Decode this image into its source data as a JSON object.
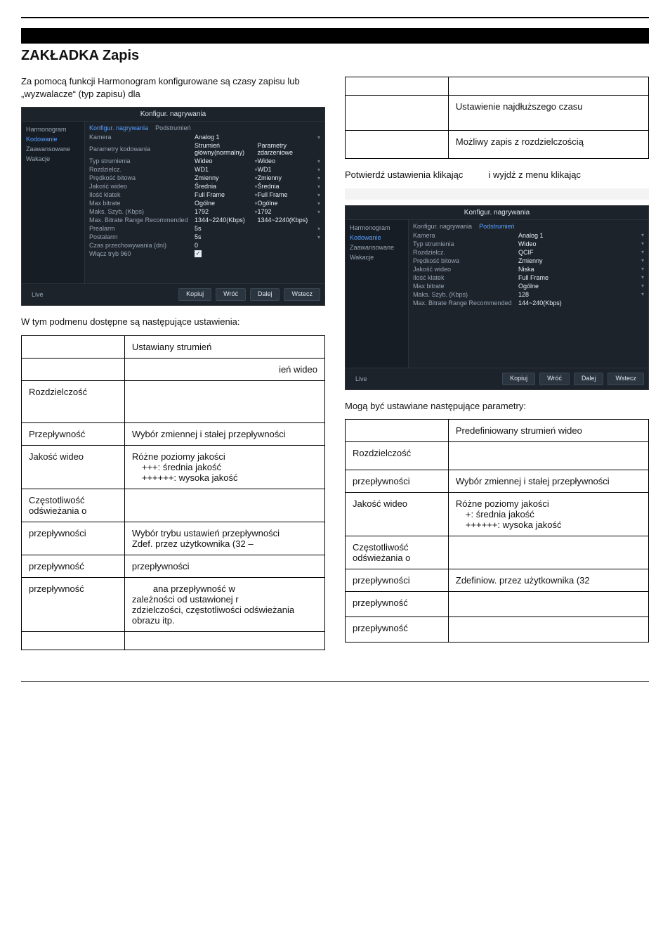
{
  "header": {
    "tab_title": "ZAKŁADKA Zapis"
  },
  "left": {
    "intro": "Za pomocą funkcji Harmonogram konfigurowane są czasy zapisu lub „wyzwalacze“ (typ zapisu) dla",
    "shot": {
      "title": "Konfigur. nagrywania",
      "side": {
        "harmonogram": "Harmonogram",
        "kodowanie": "Kodowanie",
        "zaawansowane": "Zaawansowane",
        "wakacje": "Wakacje"
      },
      "tabs": {
        "a": "Konfigur. nagrywania",
        "b": "Podstrumień"
      },
      "rows": {
        "kamera": {
          "lab": "Kamera",
          "val": "Analog 1"
        },
        "param_kod": {
          "lab": "Parametry kodowania",
          "val": "Strumień główny(normalny)",
          "val2": "Parametry zdarzeniowe"
        },
        "typ_str": {
          "lab": "Typ strumienia",
          "val": "Wideo",
          "val2": "Wideo"
        },
        "rozdz": {
          "lab": "Rozdzielcz.",
          "val": "WD1",
          "val2": "WD1"
        },
        "predk": {
          "lab": "Prędkość bitowa",
          "val": "Zmienny",
          "val2": "Zmienny"
        },
        "jakosc": {
          "lab": "Jakość wideo",
          "val": "Średnia",
          "val2": "Średnia"
        },
        "ilosc": {
          "lab": "Ilość klatek",
          "val": "Full Frame",
          "val2": "Full Frame"
        },
        "max_bit": {
          "lab": "Max bitrate",
          "val": "Ogólne",
          "val2": "Ogólne"
        },
        "maks_szyb": {
          "lab": "Maks. Szyb. (Kbps)",
          "val": "1792",
          "val2": "1792"
        },
        "range": {
          "lab": "Max. Bitrate Range Recommended",
          "val": "1344~2240(Kbps)",
          "val2": "1344~2240(Kbps)"
        },
        "prealarm": {
          "lab": "Prealarm",
          "val": "5s"
        },
        "postalarm": {
          "lab": "Postalarm",
          "val": "5s"
        },
        "czas": {
          "lab": "Czas przechowywania (dni)",
          "val": "0"
        },
        "wlacz": {
          "lab": "Włącz tryb 960"
        }
      },
      "buttons": {
        "live": "Live",
        "kopiuj": "Kopiuj",
        "wroc": "Wróć",
        "dalej": "Dalej",
        "wstecz": "Wstecz"
      }
    },
    "subhead": "W tym podmenu dostępne są następujące ustawienia:",
    "table": {
      "r1v": "Ustawiany strumień",
      "r2v": "ień wideo",
      "r3k": "Rozdzielczość",
      "r4k": "Przepływność",
      "r4v": "Wybór zmiennej i stałej przepływności",
      "r5k": "Jakość wideo",
      "r5v1": "Różne poziomy jakości",
      "r5v2": "+++: średnia jakość",
      "r5v3": "++++++: wysoka jakość",
      "r6k": "Częstotliwość odświeżania o",
      "r7k": "przepływności",
      "r7v1": "Wybór trybu ustawień przepływności",
      "r7v2": "Zdef. przez użytkownika (32 –",
      "r8k": "przepływność",
      "r8v": "przepływności",
      "r9k": "przepływność",
      "r9v1": "ana przepływność w",
      "r9v2": "zależności od ustawionej r",
      "r9v3": "zdzielczości, częstotliwości odświeżania obrazu itp."
    }
  },
  "right": {
    "top_table": {
      "r1": "Ustawienie najdłuższego czasu",
      "r2": "Możliwy zapis z rozdzielczością"
    },
    "confirm_line_a": "Potwierdź ustawienia klikając",
    "confirm_line_b": "i wyjdź z menu klikając",
    "shot": {
      "title": "Konfigur. nagrywania",
      "side": {
        "harmonogram": "Harmonogram",
        "kodowanie": "Kodowanie",
        "zaawansowane": "Zaawansowane",
        "wakacje": "Wakacje"
      },
      "tabs": {
        "a": "Konfigur. nagrywania",
        "b": "Podstrumień"
      },
      "rows": {
        "kamera": {
          "lab": "Kamera",
          "val": "Analog 1"
        },
        "typ_str": {
          "lab": "Typ strumienia",
          "val": "Wideo"
        },
        "rozdz": {
          "lab": "Rozdzielcz.",
          "val": "QCIF"
        },
        "predk": {
          "lab": "Prędkość bitowa",
          "val": "Zmienny"
        },
        "jakosc": {
          "lab": "Jakość wideo",
          "val": "Niska"
        },
        "ilosc": {
          "lab": "Ilość klatek",
          "val": "Full Frame"
        },
        "max_bit": {
          "lab": "Max bitrate",
          "val": "Ogólne"
        },
        "maks_szyb": {
          "lab": "Maks. Szyb. (Kbps)",
          "val": "128"
        },
        "range": {
          "lab": "Max. Bitrate Range Recommended",
          "val": "144~240(Kbps)"
        }
      },
      "buttons": {
        "live": "Live",
        "kopiuj": "Kopiuj",
        "wroc": "Wróć",
        "dalej": "Dalej",
        "wstecz": "Wstecz"
      }
    },
    "subhead": "Mogą być ustawiane następujące parametry:",
    "table": {
      "r1v": "Predefiniowany strumień wideo",
      "r2k": "Rozdzielczość",
      "r3k": "przepływności",
      "r3v": "Wybór zmiennej i stałej przepływności",
      "r4k": "Jakość wideo",
      "r4v1": "Różne poziomy jakości",
      "r4v2": "+: średnia jakość",
      "r4v3": "++++++: wysoka jakość",
      "r5k": "Częstotliwość odświeżania o",
      "r6k": "przepływności",
      "r6v": "Zdefiniow. przez użytkownika (32",
      "r7k": "przepływność",
      "r8k": "przepływność"
    }
  }
}
